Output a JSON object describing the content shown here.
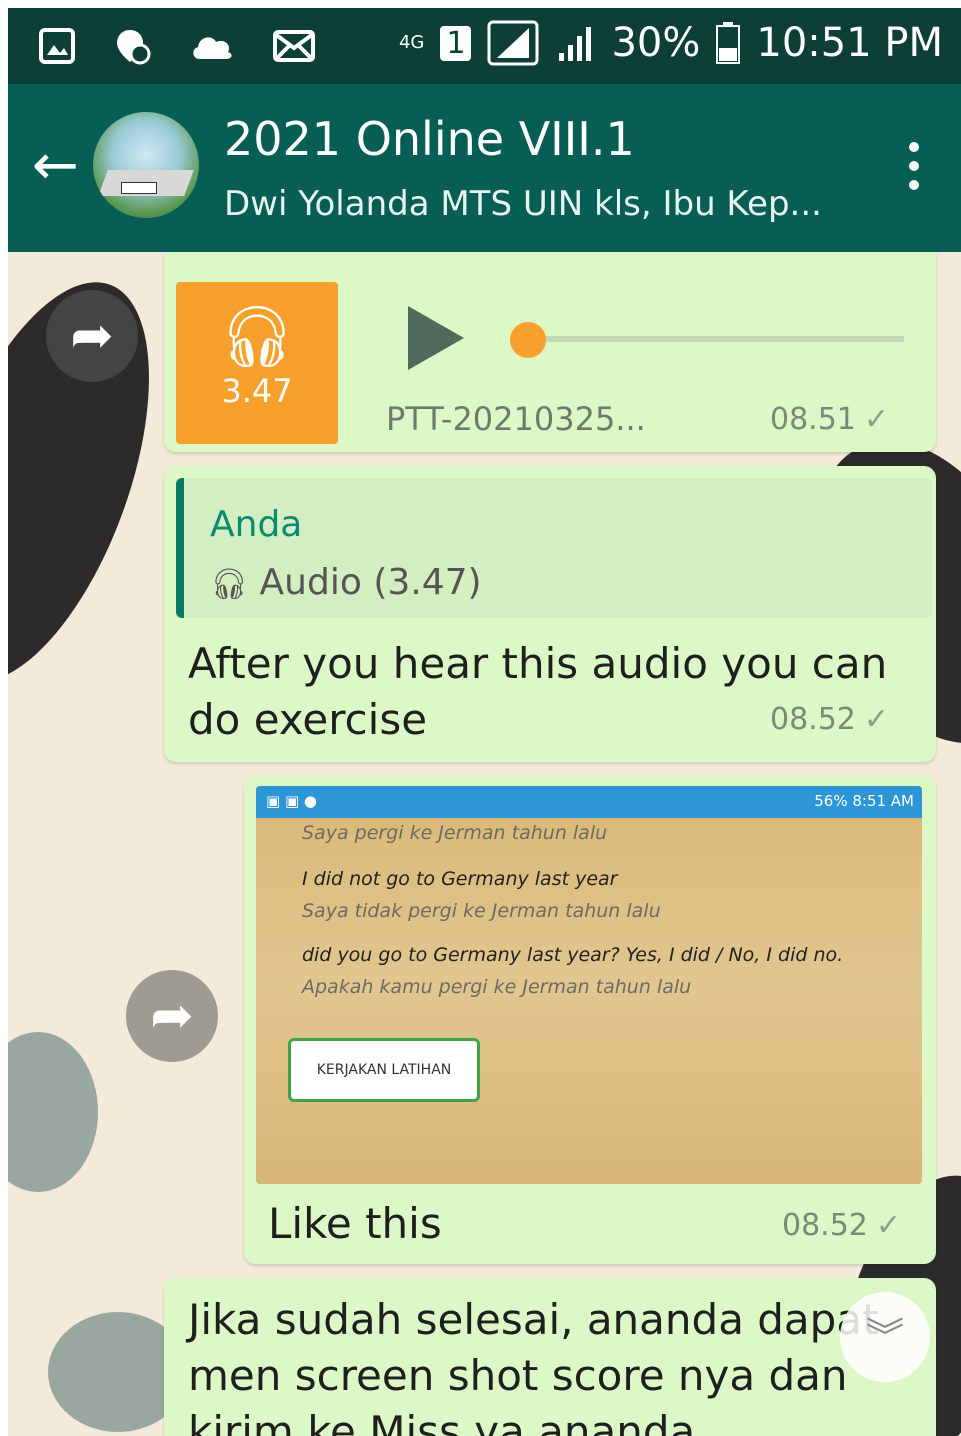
{
  "status_bar": {
    "network": "4G",
    "sim": "1",
    "battery": "30%",
    "time": "10:51 PM"
  },
  "header": {
    "title": "2021 Online VIII.1",
    "subtitle": "Dwi Yolanda MTS UIN kls, Ibu Kep..."
  },
  "messages": {
    "audio": {
      "duration": "3.47",
      "filename": "PTT-20210325...",
      "time": "08.51"
    },
    "reply": {
      "quote_sender": "Anda",
      "quote_text": "Audio (3.47)",
      "line1": "After you hear this audio you can",
      "line2": "do exercise",
      "time": "08.52"
    },
    "image": {
      "inner_status_right": "56% 8:51 AM",
      "line0": "Saya pergi ke Jerman tahun lalu",
      "line1": "I did not go to Germany last year",
      "line2": "Saya tidak pergi ke Jerman tahun lalu",
      "line3": "did you go to Germany last year? Yes, I did / No, I did no.",
      "line4": "Apakah kamu pergi ke Jerman tahun lalu",
      "button": "KERJAKAN LATIHAN",
      "caption": "Like this",
      "time": "08.52"
    },
    "last": {
      "line1": "Jika sudah selesai, ananda dapat",
      "line2": "men screen shot score nya dan",
      "line3": "kirim ke Miss ya ananda."
    }
  },
  "icons": [
    "gallery-icon",
    "location-icon",
    "cloud-icon",
    "mail-icon",
    "signal-icon",
    "battery-icon",
    "back-arrow-icon",
    "more-icon",
    "forward-icon",
    "headphones-icon",
    "play-icon",
    "check-icon",
    "scroll-down-icon"
  ]
}
